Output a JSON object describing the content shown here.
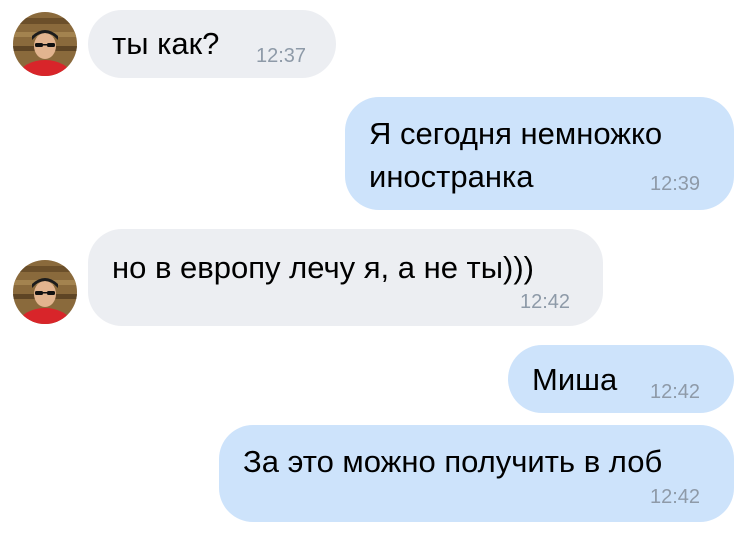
{
  "conversation": {
    "messages": [
      {
        "direction": "incoming",
        "text": "ты как?",
        "time": "12:37"
      },
      {
        "direction": "outgoing",
        "lines": [
          "Я сегодня немножко",
          "иностранка"
        ],
        "time": "12:39"
      },
      {
        "direction": "incoming",
        "text": "но в европу лечу я, а не ты)))",
        "time": "12:42"
      },
      {
        "direction": "outgoing",
        "text": "Миша",
        "time": "12:42"
      },
      {
        "direction": "outgoing",
        "text": "За это можно получить в лоб",
        "time": "12:42"
      }
    ]
  },
  "colors": {
    "incoming_bubble": "#eceef2",
    "outgoing_bubble": "#cde3fb",
    "timestamp": "#8e9aa8"
  },
  "icons": {
    "avatar": "user-avatar-photo"
  }
}
